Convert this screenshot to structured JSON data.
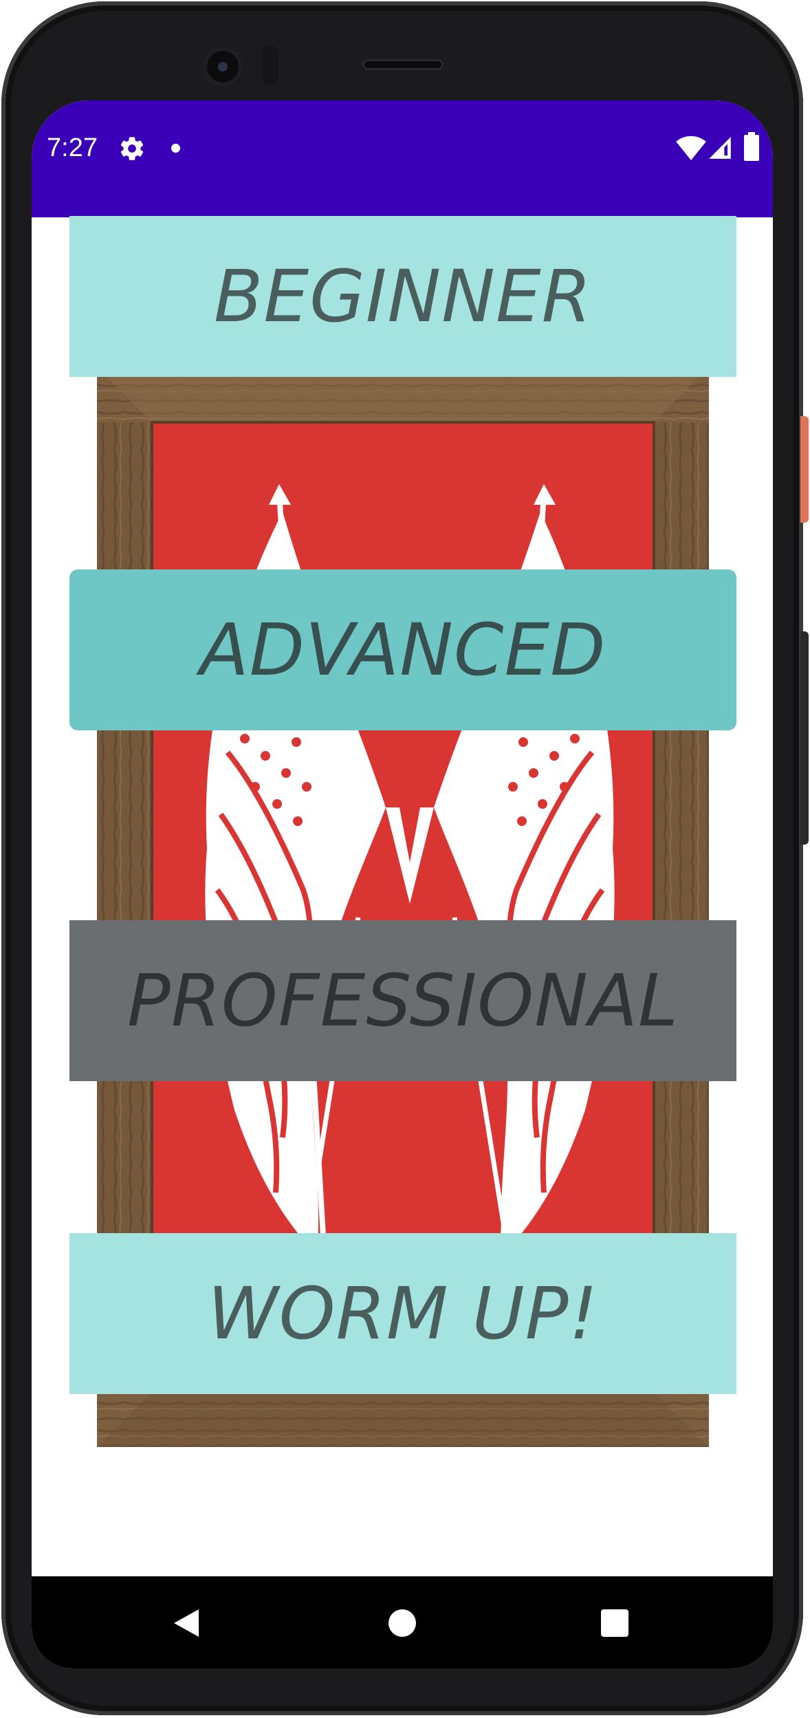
{
  "status_bar": {
    "time": "7:27",
    "background_color": "#3a00b8",
    "icons": [
      "settings-gear-icon",
      "notification-dot-icon",
      "wifi-icon",
      "cell-signal-icon",
      "battery-icon"
    ]
  },
  "menu": {
    "buttons": [
      {
        "label": "BEGINNER",
        "color": "#a5e3e0"
      },
      {
        "label": "ADVANCED",
        "color": "#6ec7c4"
      },
      {
        "label": "PROFESSIONAL",
        "color": "#6b6e70"
      },
      {
        "label": "WORM UP!",
        "color": "#a5e3e0"
      }
    ]
  },
  "background_image": {
    "description_icon": "framed-crossed-flags-image",
    "frame_color": "#7a5c3e",
    "panel_color": "#d93532"
  },
  "nav_bar": {
    "icons": [
      "back-icon",
      "home-icon",
      "recents-icon"
    ]
  }
}
